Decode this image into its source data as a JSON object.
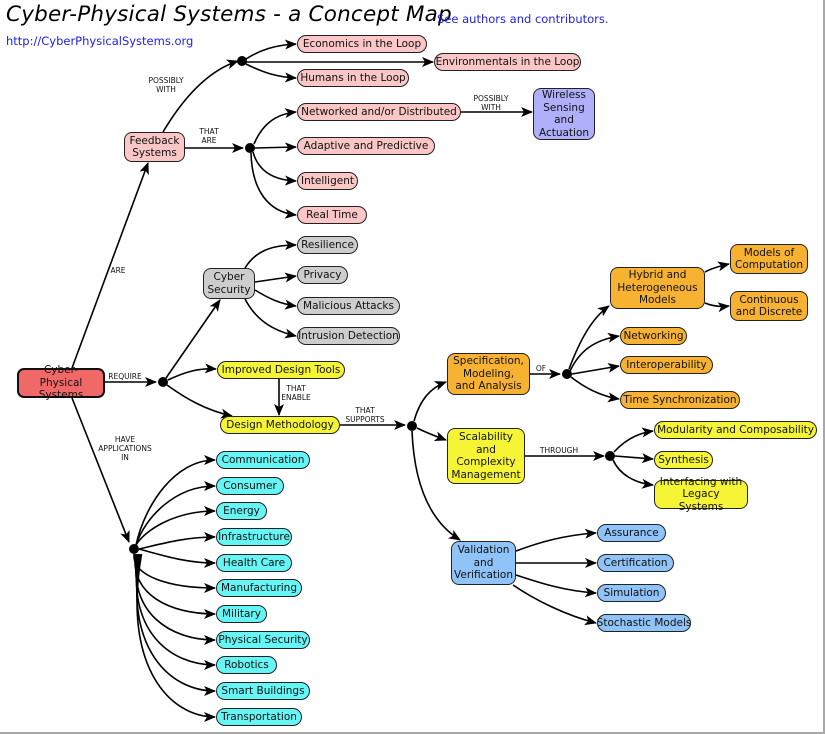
{
  "header": {
    "title": "Cyber-Physical Systems - a Concept Map",
    "site_link": "http://CyberPhysicalSystems.org",
    "authors_link": "See authors and contributors."
  },
  "colors": {
    "root": "#f06868",
    "pink": "#fbc6c6",
    "gray": "#cdcdcd",
    "yellow": "#f5f536",
    "orange": "#f8b232",
    "cyan": "#66f5f5",
    "blue": "#90c4f8",
    "violet": "#b0b0fa"
  },
  "nodes": {
    "cps": "Cyber-Physical Systems",
    "feedback": "Feedback Systems",
    "economics": "Economics in the Loop",
    "environmentals": "Environmentals in the Loop",
    "humans": "Humans in the Loop",
    "networked": "Networked and/or Distributed",
    "wireless": "Wireless Sensing and Actuation",
    "adaptive": "Adaptive and Predictive",
    "intelligent": "Intelligent",
    "realtime": "Real Time",
    "cyber": "Cyber Security",
    "resilience": "Resilience",
    "privacy": "Privacy",
    "malicious": "Malicious Attacks",
    "intrusion": "Intrusion Detection",
    "tools": "Improved Design Tools",
    "method": "Design Methodology",
    "spec": "Specification, Modeling, and Analysis",
    "hybrid": "Hybrid and Heterogeneous Models",
    "moc": "Models of Computation",
    "contdisc": "Continuous and Discrete",
    "networking": "Networking",
    "interop": "Interoperability",
    "timesync": "Time Synchronization",
    "scal": "Scalability and Complexity Management",
    "modular": "Modularity and Composability",
    "synthesis": "Synthesis",
    "legacy": "Interfacing with Legacy Systems",
    "vv": "Validation and Verification",
    "assurance": "Assurance",
    "certification": "Certification",
    "simulation": "Simulation",
    "stochastic": "Stochastic Models",
    "app_communication": "Communication",
    "app_consumer": "Consumer",
    "app_energy": "Energy",
    "app_infrastructure": "Infrastructure",
    "app_health": "Health Care",
    "app_manufacturing": "Manufacturing",
    "app_military": "Military",
    "app_physsec": "Physical Security",
    "app_robotics": "Robotics",
    "app_smartbuildings": "Smart Buildings",
    "app_transportation": "Transportation"
  },
  "labels": {
    "are": "ARE",
    "possibly_with_1": "POSSIBLY\nWITH",
    "that_are": "THAT\nARE",
    "possibly_with_2": "POSSIBLY\nWITH",
    "require": "REQUIRE",
    "have_applications_in": "HAVE\nAPPLICATIONS\nIN",
    "that_enable": "THAT\nENABLE",
    "that_supports": "THAT\nSUPPORTS",
    "of": "OF",
    "through": "THROUGH"
  }
}
